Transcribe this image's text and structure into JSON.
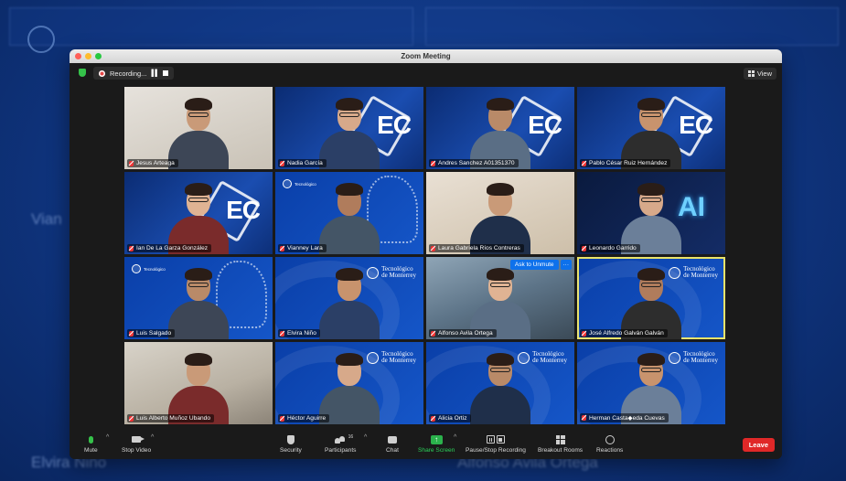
{
  "window": {
    "title": "Zoom Meeting"
  },
  "topbar": {
    "recording_label": "Recording...",
    "view_label": "View"
  },
  "tiles": [
    {
      "name": "Jesus Arteaga",
      "bg": "office"
    },
    {
      "name": "Nadia García",
      "bg": "ec"
    },
    {
      "name": "Andres Sanchez A01351370",
      "bg": "ec"
    },
    {
      "name": "Pablo César Ruiz Hernández",
      "bg": "ec"
    },
    {
      "name": "Ian De La Garza González",
      "bg": "ec"
    },
    {
      "name": "Vianney Lara",
      "bg": "brain"
    },
    {
      "name": "Laura Gabriela Ríos Contreras",
      "bg": "warm"
    },
    {
      "name": "Leonardo Garrido",
      "bg": "ai"
    },
    {
      "name": "Luis Salgado",
      "bg": "brain"
    },
    {
      "name": "Elvira Niño",
      "bg": "tec"
    },
    {
      "name": "Alfonso Avila Ortega",
      "bg": "lab"
    },
    {
      "name": "José Alfredo Galván Galván",
      "bg": "tec"
    },
    {
      "name": "Luis Alberto Muñoz Ubando",
      "bg": "room"
    },
    {
      "name": "Héctor Aguirre",
      "bg": "tec"
    },
    {
      "name": "Alicia Ortiz",
      "bg": "tec"
    },
    {
      "name": "Herman Casta◆eda Cuevas",
      "bg": "tec"
    }
  ],
  "tile_overlay": {
    "ask_unmute": "Ask to Unmute",
    "more": "···"
  },
  "backdrop": {
    "tec_logo_line1": "Tecnológico",
    "tec_logo_line2": "de Monterrey",
    "ec_text": "EC",
    "ai_text": "AI"
  },
  "toolbar": {
    "mute": "Mute",
    "stop_video": "Stop Video",
    "security": "Security",
    "participants": "Participants",
    "participant_count": "16",
    "chat": "Chat",
    "share_screen": "Share Screen",
    "pause_stop_recording": "Pause/Stop Recording",
    "breakout_rooms": "Breakout Rooms",
    "reactions": "Reactions",
    "leave": "Leave"
  },
  "background_ghosts": {
    "left_name": "Vian",
    "bottom_left": "Elvira Niño",
    "bottom_right": "Alfonso Avila Ortega"
  },
  "colors": {
    "accent_blue": "#0e71eb",
    "leave_red": "#e02828",
    "share_green": "#2bb24c",
    "active_speaker": "#e9e36a"
  }
}
